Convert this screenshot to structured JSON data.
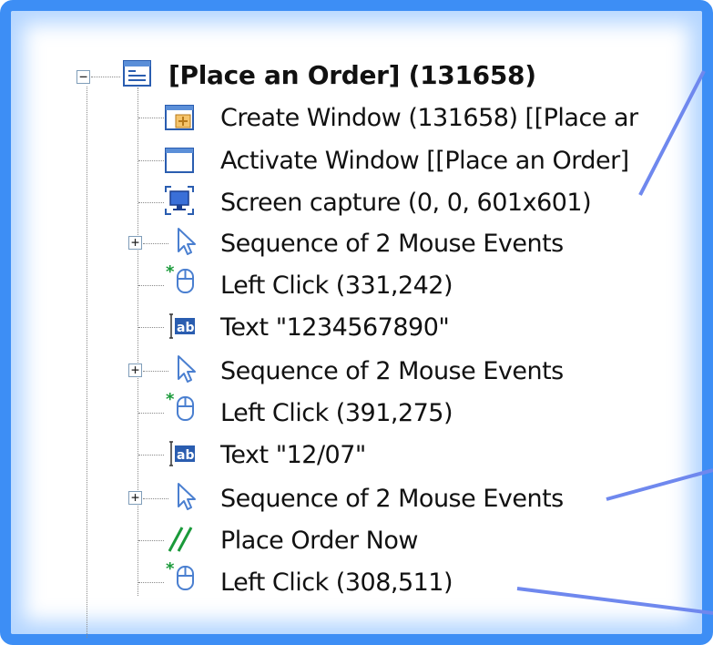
{
  "tree": {
    "root": {
      "label": "[Place an Order] (131658)",
      "expander": "−",
      "icon": "window-list-icon"
    },
    "items": [
      {
        "label": "Create Window (131658) [[Place ar",
        "icon": "create-window-icon",
        "expander": null
      },
      {
        "label": "Activate Window [[Place an Order]",
        "icon": "window-icon",
        "expander": null
      },
      {
        "label": "Screen capture (0, 0, 601x601)",
        "icon": "screen-capture-icon",
        "expander": null
      },
      {
        "label": "Sequence of 2  Mouse Events",
        "icon": "cursor-icon",
        "expander": "+"
      },
      {
        "label": "Left Click (331,242)",
        "icon": "mouse-click-icon",
        "expander": null
      },
      {
        "label": "Text \"1234567890\"",
        "icon": "text-ab-icon",
        "expander": null
      },
      {
        "label": "Sequence of 2  Mouse Events",
        "icon": "cursor-icon",
        "expander": "+"
      },
      {
        "label": "Left Click (391,275)",
        "icon": "mouse-click-icon",
        "expander": null
      },
      {
        "label": "Text \"12/07\"",
        "icon": "text-ab-icon",
        "expander": null
      },
      {
        "label": "Sequence of 2  Mouse Events",
        "icon": "cursor-icon",
        "expander": "+"
      },
      {
        "label": "Place Order Now",
        "icon": "comment-slash-icon",
        "expander": null
      },
      {
        "label": "Left Click (308,511)",
        "icon": "mouse-click-icon",
        "expander": null
      }
    ]
  },
  "colors": {
    "frame": "#3d8ef5",
    "callout": "#6f88ee",
    "text": "#111111"
  }
}
